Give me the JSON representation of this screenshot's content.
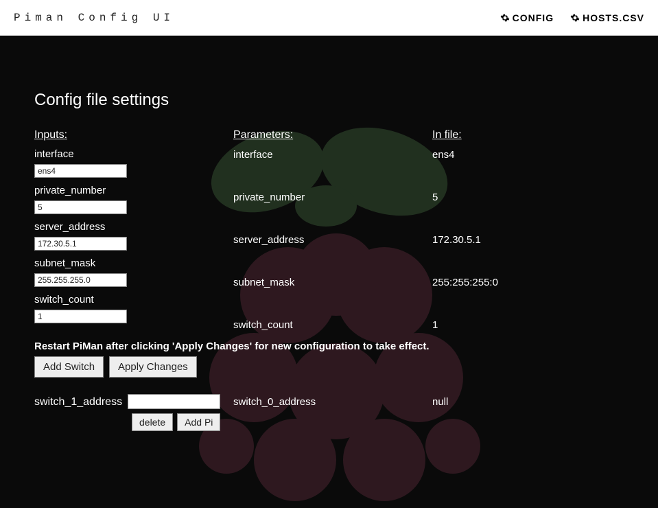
{
  "header": {
    "brand": "Piman Config UI",
    "nav": [
      {
        "label": "CONFIG"
      },
      {
        "label": "HOSTS.CSV"
      }
    ]
  },
  "page": {
    "title": "Config file settings",
    "columns": {
      "inputs": "Inputs:",
      "parameters": "Parameters:",
      "in_file": "In file:"
    }
  },
  "fields": [
    {
      "label": "interface",
      "value": "ens4",
      "param": "interface",
      "file_value": "ens4"
    },
    {
      "label": "private_number",
      "value": "5",
      "param": "private_number",
      "file_value": "5"
    },
    {
      "label": "server_address",
      "value": "172.30.5.1",
      "param": "server_address",
      "file_value": "172.30.5.1"
    },
    {
      "label": "subnet_mask",
      "value": "255.255.255.0",
      "param": "subnet_mask",
      "file_value": "255:255:255:0"
    },
    {
      "label": "switch_count",
      "value": "1",
      "param": "switch_count",
      "file_value": "1"
    }
  ],
  "notice": "Restart PiMan after clicking 'Apply Changes' for new configuration to take effect.",
  "buttons": {
    "add_switch": "Add Switch",
    "apply_changes": "Apply Changes",
    "delete": "delete",
    "add_pi": "Add Pi"
  },
  "switch_section": {
    "input_label": "switch_1_address",
    "input_value": "",
    "param": "switch_0_address",
    "file_value": "null"
  }
}
